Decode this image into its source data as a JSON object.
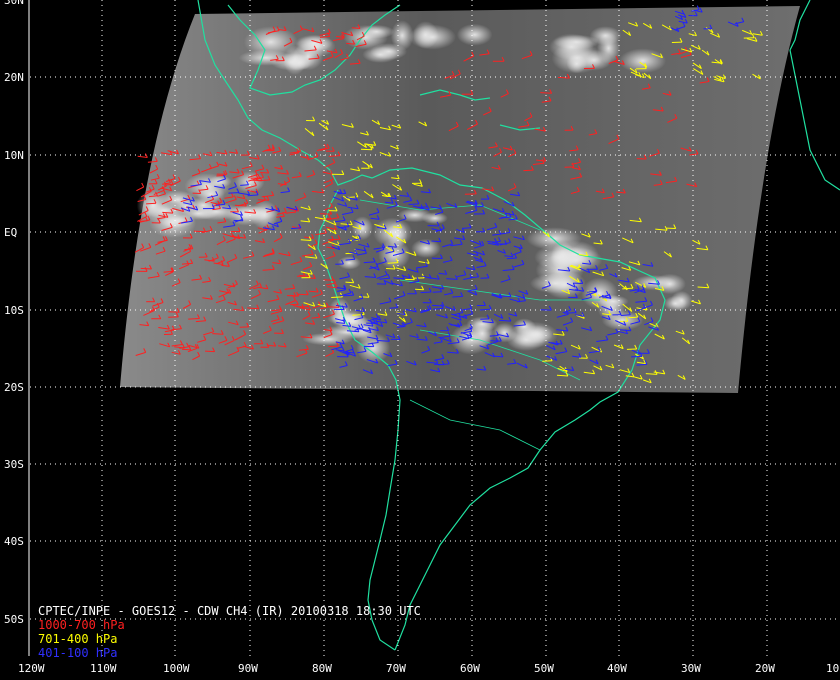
{
  "title": "CPTEC/INPE - GOES12 - CDW CH4 (IR) 20100318 18:30 UTC",
  "legend": [
    {
      "label": "1000-700 hPa",
      "color": "#ff2020"
    },
    {
      "label": "701-400 hPa",
      "color": "#ffff00"
    },
    {
      "label": "401-100 hPa",
      "color": "#2020ff"
    }
  ],
  "lat_labels": [
    "30N",
    "20N",
    "10N",
    "EQ",
    "10S",
    "20S",
    "30S",
    "40S",
    "50S"
  ],
  "lon_labels": [
    "120W",
    "110W",
    "100W",
    "90W",
    "80W",
    "70W",
    "60W",
    "50W",
    "40W",
    "30W",
    "20W",
    "10"
  ],
  "colors": {
    "background": "#000000",
    "coastline": "#20e0a0",
    "grid": "#ffffff",
    "imagery": "#7a7a7a"
  }
}
